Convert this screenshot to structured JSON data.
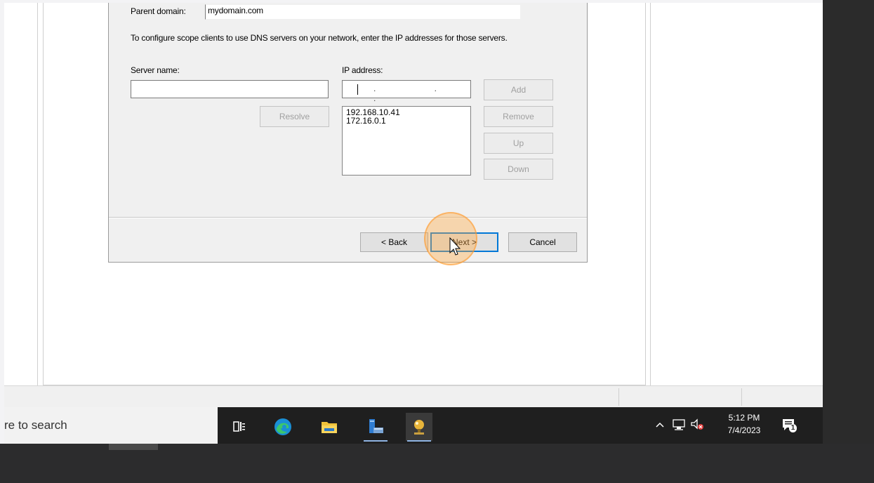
{
  "wizard": {
    "parent_domain_label": "Parent domain:",
    "parent_domain_value": "mydomain.com",
    "instructions": "To configure scope clients to use DNS servers on your network, enter the IP addresses for those servers.",
    "server_name_label": "Server name:",
    "server_name_value": "",
    "ip_address_label": "IP address:",
    "ip_address_value": ". . .",
    "ip_list": [
      "192.168.10.41",
      "172.16.0.1"
    ],
    "buttons": {
      "add": "Add",
      "resolve": "Resolve",
      "remove": "Remove",
      "up": "Up",
      "down": "Down",
      "back": "< Back",
      "next": "Next >",
      "cancel": "Cancel"
    }
  },
  "taskbar": {
    "search_text": "re to search",
    "apps": [
      "task-view-icon",
      "edge-icon",
      "file-explorer-icon",
      "server-manager-icon",
      "dhcp-icon"
    ],
    "time": "5:12 PM",
    "date": "7/4/2023",
    "notification_count": "1"
  }
}
